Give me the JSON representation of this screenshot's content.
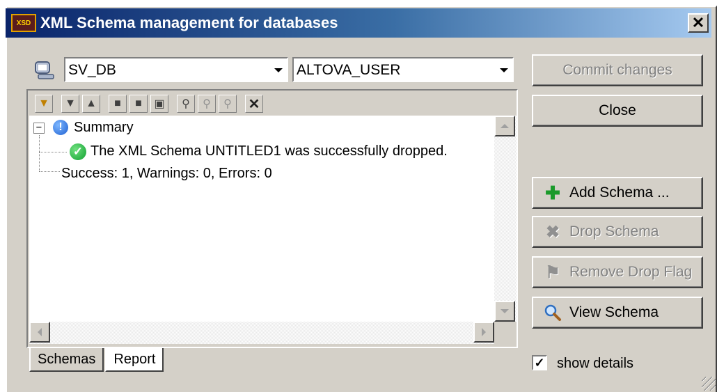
{
  "window": {
    "title": "XML Schema management for databases",
    "icon_label": "XSD",
    "close_glyph": "✕"
  },
  "connection": {
    "database_value": "SV_DB",
    "user_value": "ALTOVA_USER"
  },
  "buttons": {
    "commit": "Commit changes",
    "close": "Close",
    "add_schema": "Add Schema ...",
    "drop_schema": "Drop Schema",
    "remove_drop_flag": "Remove Drop Flag",
    "view_schema": "View Schema"
  },
  "toolbar_icons": [
    "filter-icon",
    "move-down-icon",
    "move-up-icon",
    "copy-icon",
    "paste-icon",
    "save-icon",
    "find-icon",
    "find-next-icon",
    "find-previous-icon",
    "clear-icon"
  ],
  "report": {
    "summary_label": "Summary",
    "message": "The XML Schema UNTITLED1 was successfully dropped.",
    "totals": "Success: 1, Warnings: 0, Errors: 0",
    "expander_glyph": "−"
  },
  "tabs": {
    "schemas": "Schemas",
    "report": "Report",
    "active": "Report"
  },
  "show_details": {
    "label": "show details",
    "checked": true,
    "check_glyph": "✓"
  }
}
